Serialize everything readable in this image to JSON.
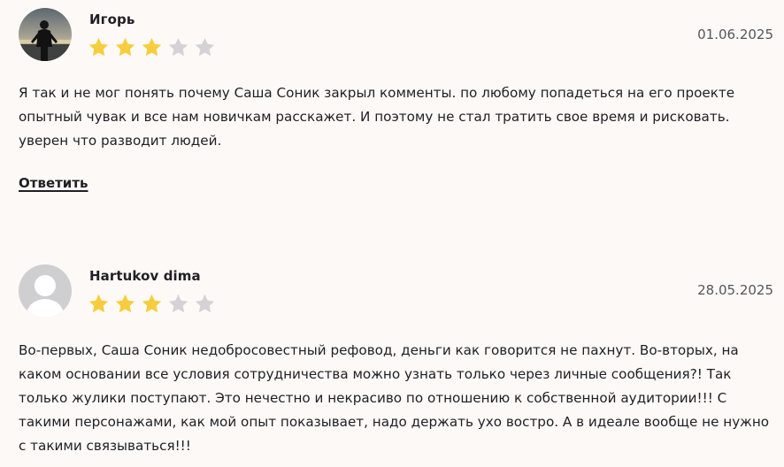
{
  "reviews": [
    {
      "author": "Игорь",
      "date": "01.06.2025",
      "rating": 3,
      "rating_max": 5,
      "text": "Я так и не мог понять почему Саша Соник закрыл комменты. по любому попадеться на его проекте опытный чувак и все нам новичкам расскажет. И поэтому не стал тратить свое время и рисковать. уверен что разводит людей.",
      "reply_label": "Ответить",
      "avatar": "user-photo-icon"
    },
    {
      "author": "Hartukov dima",
      "date": "28.05.2025",
      "rating": 3,
      "rating_max": 5,
      "text": "Во-первых, Саша Соник недобросовестный рефовод, деньги как говорится не пахнут. Во-вторых, на каком основании все условия сотрудничества можно узнать только через личные сообщения?! Так только жулики поступают. Это нечестно и некрасиво по отношению к собственной аудитории!!! С такими персонажами, как мой опыт показывает, надо держать ухо востро. А в идеале вообще не нужно с такими связываться!!!",
      "avatar": "default-avatar-icon"
    }
  ],
  "colors": {
    "background": "#fcf9f6",
    "star_filled": "#f6cd3d",
    "star_empty": "#d3d3d6",
    "text": "#1f1f24",
    "date": "#55555c"
  }
}
